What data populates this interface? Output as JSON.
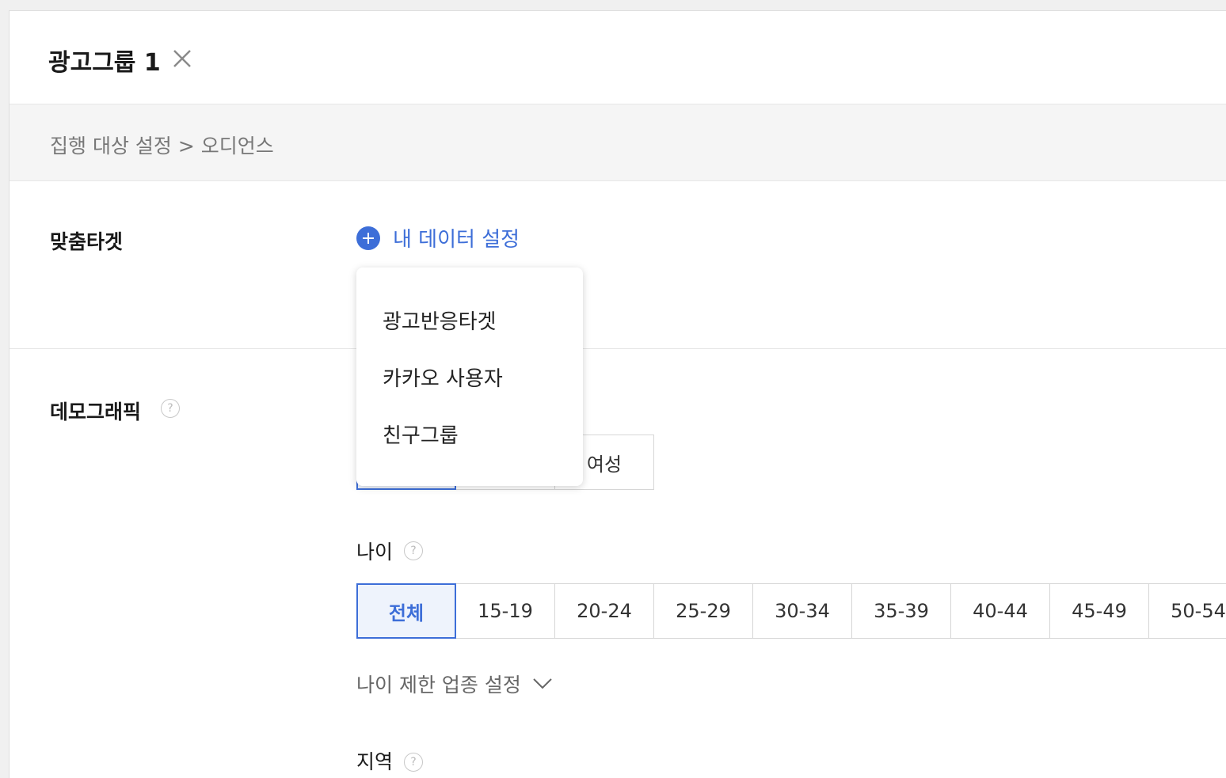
{
  "header": {
    "title": "광고그룹 1",
    "close_icon": "close-icon"
  },
  "breadcrumb": "집행 대상 설정 > 오디언스",
  "custom_target": {
    "label": "맞춤타겟",
    "add_button_label": "내 데이터 설정",
    "add_icon": "plus-circle-icon",
    "dropdown_items": [
      "광고반응타겟",
      "카카오 사용자",
      "친구그룹"
    ]
  },
  "demographic": {
    "label": "데모그래픽",
    "help_icon": "help-icon",
    "help_glyph": "?",
    "gender": {
      "options": [
        "",
        "",
        "여성"
      ],
      "selected_index": 0
    },
    "age": {
      "label": "나이",
      "options": [
        "전체",
        "15-19",
        "20-24",
        "25-29",
        "30-34",
        "35-39",
        "40-44",
        "45-49",
        "50-54"
      ],
      "selected_index": 0
    },
    "age_restriction_label": "나이 제한 업종 설정",
    "region_label": "지역"
  },
  "colors": {
    "accent": "#3d6ed8",
    "selected_bg": "#eef3fc",
    "panel_bg": "#ffffff",
    "subheader_bg": "#f5f5f5"
  }
}
